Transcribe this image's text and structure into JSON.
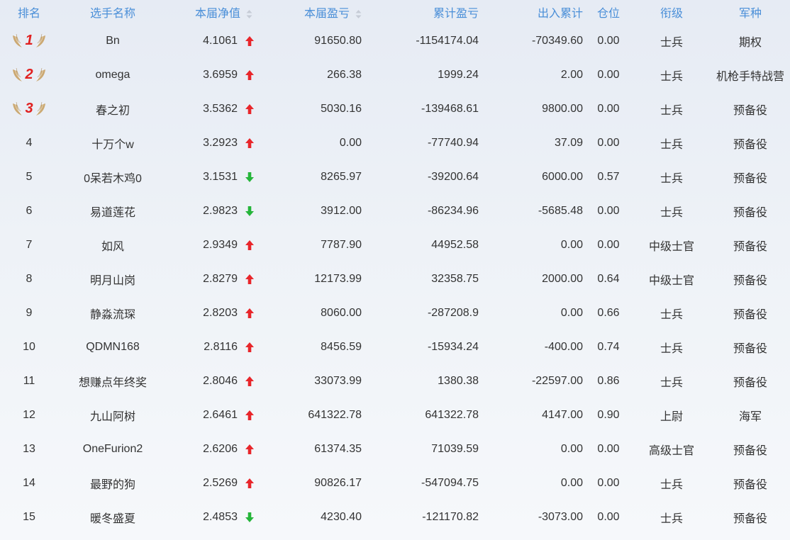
{
  "headers": {
    "rank": "排名",
    "name": "选手名称",
    "net": "本届净值",
    "pnl": "本届盈亏",
    "cum": "累计盈亏",
    "flow": "出入累计",
    "position": "仓位",
    "title": "衔级",
    "branch": "军种"
  },
  "colors": {
    "header": "#4a8fd8",
    "up": "#e8262b",
    "down": "#25b53a",
    "medal": "#c9a46a",
    "medal_number": "#e02020"
  },
  "rows": [
    {
      "rank": "1",
      "name": "Bn",
      "net": "4.1061",
      "trend": "up",
      "pnl": "91650.80",
      "cum": "-1154174.04",
      "flow": "-70349.60",
      "position": "0.00",
      "title": "士兵",
      "branch": "期权"
    },
    {
      "rank": "2",
      "name": "omega",
      "net": "3.6959",
      "trend": "up",
      "pnl": "266.38",
      "cum": "1999.24",
      "flow": "2.00",
      "position": "0.00",
      "title": "士兵",
      "branch": "机枪手特战营"
    },
    {
      "rank": "3",
      "name": "春之初",
      "net": "3.5362",
      "trend": "up",
      "pnl": "5030.16",
      "cum": "-139468.61",
      "flow": "9800.00",
      "position": "0.00",
      "title": "士兵",
      "branch": "预备役"
    },
    {
      "rank": "4",
      "name": "十万个w",
      "net": "3.2923",
      "trend": "up",
      "pnl": "0.00",
      "cum": "-77740.94",
      "flow": "37.09",
      "position": "0.00",
      "title": "士兵",
      "branch": "预备役"
    },
    {
      "rank": "5",
      "name": "0呆若木鸡0",
      "net": "3.1531",
      "trend": "down",
      "pnl": "8265.97",
      "cum": "-39200.64",
      "flow": "6000.00",
      "position": "0.57",
      "title": "士兵",
      "branch": "预备役"
    },
    {
      "rank": "6",
      "name": "易道莲花",
      "net": "2.9823",
      "trend": "down",
      "pnl": "3912.00",
      "cum": "-86234.96",
      "flow": "-5685.48",
      "position": "0.00",
      "title": "士兵",
      "branch": "预备役"
    },
    {
      "rank": "7",
      "name": "如风",
      "net": "2.9349",
      "trend": "up",
      "pnl": "7787.90",
      "cum": "44952.58",
      "flow": "0.00",
      "position": "0.00",
      "title": "中级士官",
      "branch": "预备役"
    },
    {
      "rank": "8",
      "name": "明月山岗",
      "net": "2.8279",
      "trend": "up",
      "pnl": "12173.99",
      "cum": "32358.75",
      "flow": "2000.00",
      "position": "0.64",
      "title": "中级士官",
      "branch": "预备役"
    },
    {
      "rank": "9",
      "name": "静淼流琛",
      "net": "2.8203",
      "trend": "up",
      "pnl": "8060.00",
      "cum": "-287208.9",
      "flow": "0.00",
      "position": "0.66",
      "title": "士兵",
      "branch": "预备役"
    },
    {
      "rank": "10",
      "name": "QDMN168",
      "net": "2.8116",
      "trend": "up",
      "pnl": "8456.59",
      "cum": "-15934.24",
      "flow": "-400.00",
      "position": "0.74",
      "title": "士兵",
      "branch": "预备役"
    },
    {
      "rank": "11",
      "name": "想赚点年终奖",
      "net": "2.8046",
      "trend": "up",
      "pnl": "33073.99",
      "cum": "1380.38",
      "flow": "-22597.00",
      "position": "0.86",
      "title": "士兵",
      "branch": "预备役"
    },
    {
      "rank": "12",
      "name": "九山阿树",
      "net": "2.6461",
      "trend": "up",
      "pnl": "641322.78",
      "cum": "641322.78",
      "flow": "4147.00",
      "position": "0.90",
      "title": "上尉",
      "branch": "海军"
    },
    {
      "rank": "13",
      "name": "OneFurion2",
      "net": "2.6206",
      "trend": "up",
      "pnl": "61374.35",
      "cum": "71039.59",
      "flow": "0.00",
      "position": "0.00",
      "title": "高级士官",
      "branch": "预备役"
    },
    {
      "rank": "14",
      "name": "最野的狗",
      "net": "2.5269",
      "trend": "up",
      "pnl": "90826.17",
      "cum": "-547094.75",
      "flow": "0.00",
      "position": "0.00",
      "title": "士兵",
      "branch": "预备役"
    },
    {
      "rank": "15",
      "name": "暖冬盛夏",
      "net": "2.4853",
      "trend": "down",
      "pnl": "4230.40",
      "cum": "-121170.82",
      "flow": "-3073.00",
      "position": "0.00",
      "title": "士兵",
      "branch": "预备役"
    }
  ]
}
